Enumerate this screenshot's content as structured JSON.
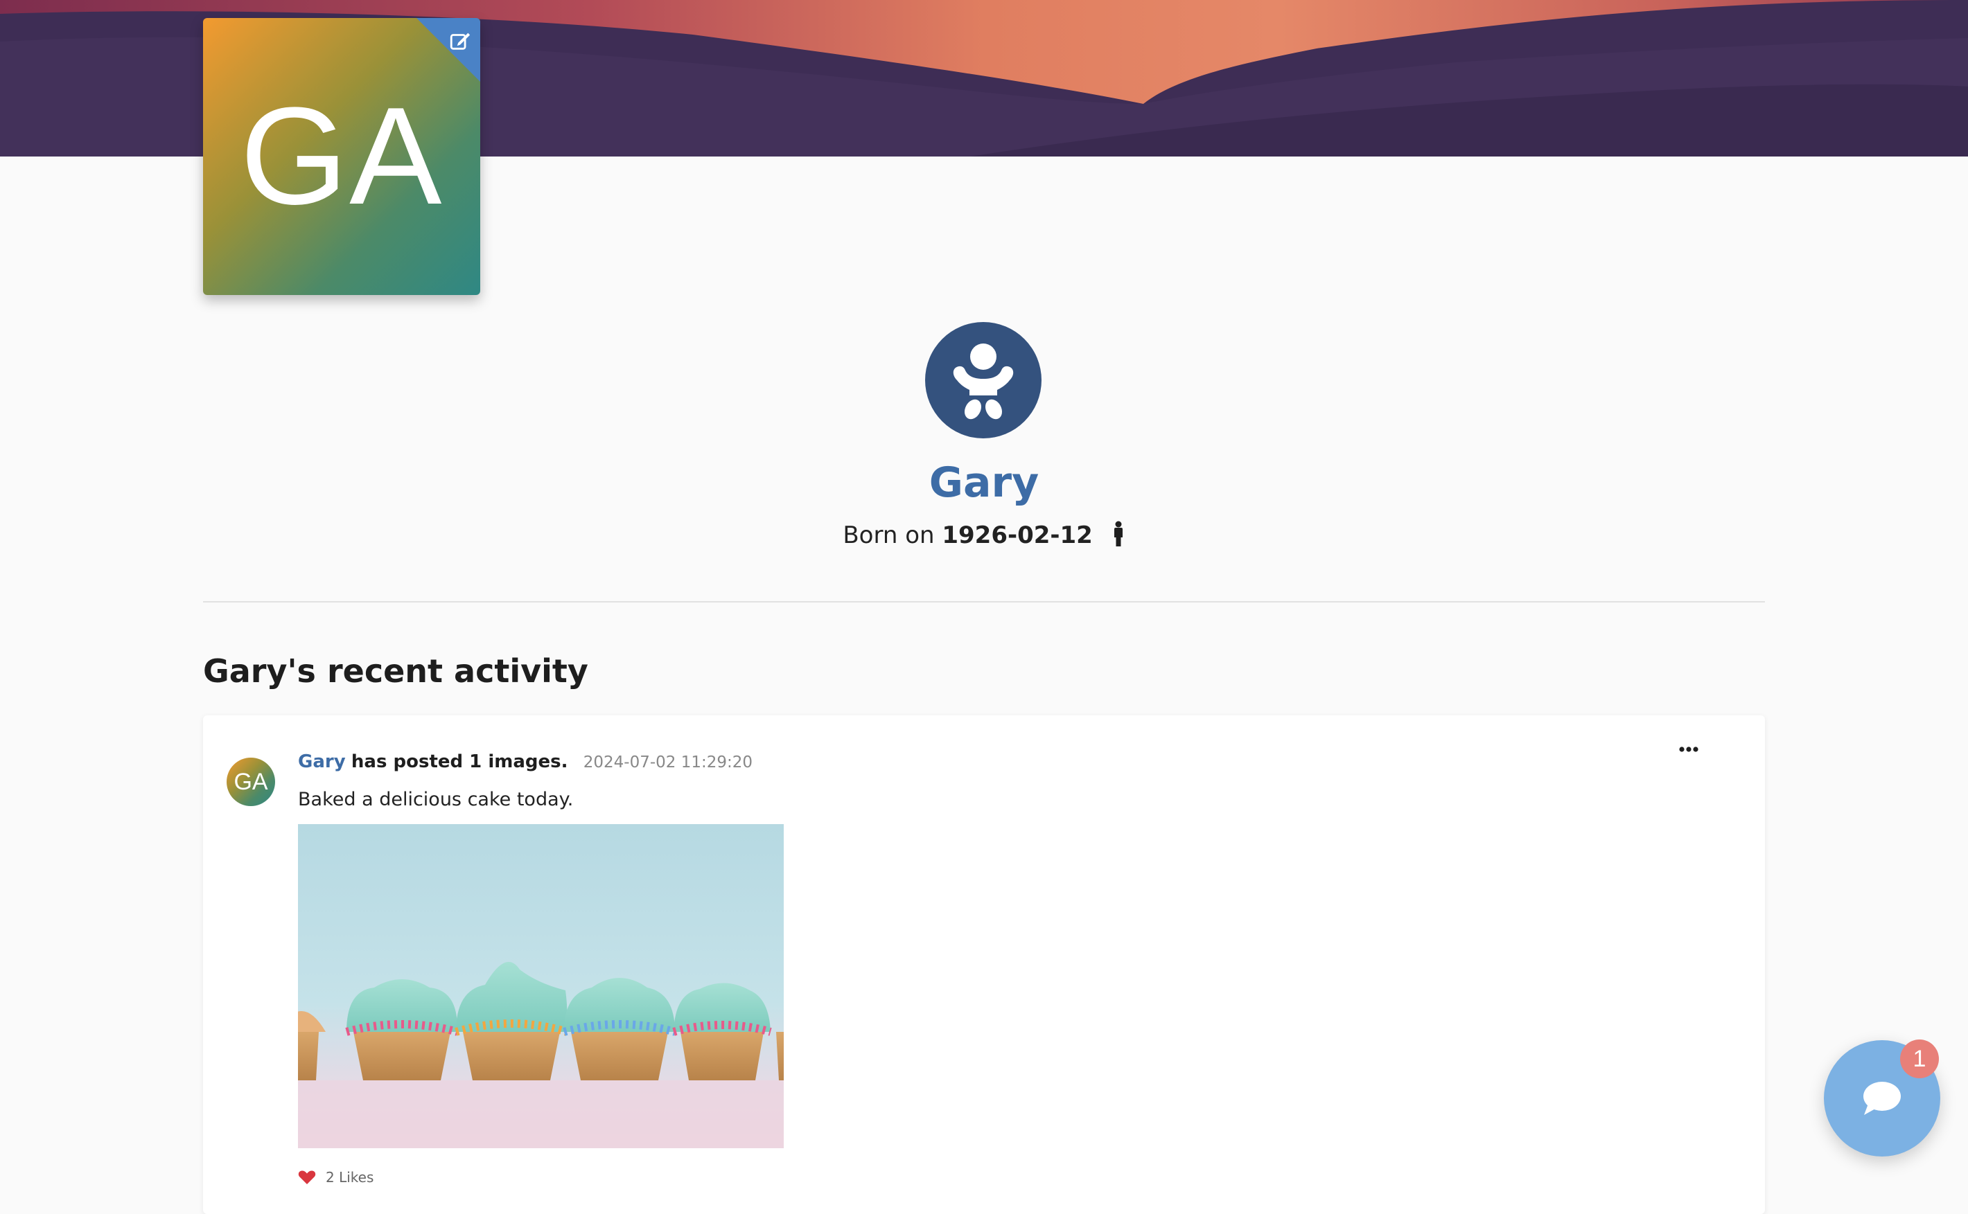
{
  "banner": {
    "colors": {
      "base": "#3e2d55",
      "sunset_orange": "#e58466",
      "sunset_red": "#b64b57"
    }
  },
  "profile": {
    "initials": "GA",
    "edit_icon": "edit-icon",
    "person_icon": "baby-icon",
    "name": "Gary",
    "born_prefix": "Born on",
    "birth_date": "1926-02-12",
    "gender_icon": "male-icon"
  },
  "activity": {
    "title": "Gary's recent activity",
    "posts": [
      {
        "avatar_initials": "GA",
        "author": "Gary",
        "action": "has posted 1 images.",
        "timestamp": "2024-07-02 11:29:20",
        "text": "Baked a delicious cake today.",
        "image_icon": "cupcakes-photo",
        "likes_label": "2 Likes",
        "more_icon": "more-options-icon"
      }
    ]
  },
  "chat": {
    "icon": "chat-bubble-icon",
    "badge_count": "1"
  },
  "colors": {
    "accent": "#3d6ca6",
    "person_circle": "#34527e",
    "chat_fab": "#7cb1e3",
    "badge": "#e88079"
  }
}
